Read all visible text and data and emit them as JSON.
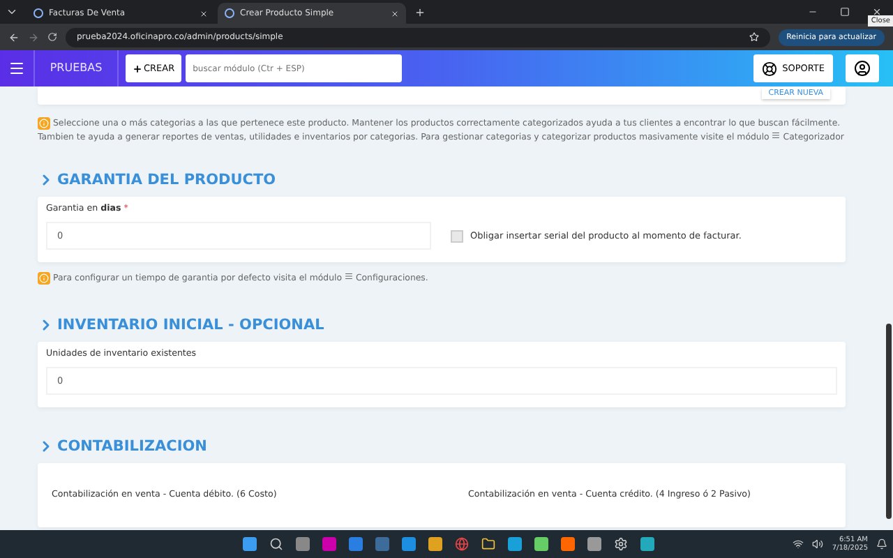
{
  "browser": {
    "tabs": [
      {
        "title": "Facturas De Venta",
        "selected": false
      },
      {
        "title": "Crear Producto Simple",
        "selected": true
      }
    ],
    "url": "prueba2024.oficinapro.co/admin/products/simple",
    "update_button": "Reinicia para actualizar",
    "tooltip": "Close"
  },
  "header": {
    "company": "PRUEBAS",
    "create_button": "CREAR",
    "search": {
      "placeholder": "buscar módulo (Ctr + ESP)"
    },
    "support_button": "SOPORTE"
  },
  "top_card": {
    "button": "CREAR NUEVA"
  },
  "category_note": {
    "text": "Seleccione una o más categorias a las que pertenece este producto. Mantener los productos correctamente categorizados ayuda a tus clientes a encontrar lo que buscan fácilmente. Tambien te ayuda a generar reportes de ventas, utilidades e inventarios por categorias. Para gestionar categorias y categorizar productos masivamente visite el módulo",
    "link": "Categorizador"
  },
  "sections": [
    {
      "title": "GARANTIA DEL PRODUCTO",
      "kind": "warranty",
      "label": "Garantia en **dias**",
      "required_mark": "*",
      "value": "0",
      "checkbox": {
        "label": "Obligar insertar serial del producto al momento de facturar.",
        "checked": false
      },
      "note": {
        "text": "Para configurar un tiempo de garantia por defecto visita el módulo",
        "link": "Configuraciones."
      }
    },
    {
      "title": "INVENTARIO INICIAL - OPCIONAL",
      "kind": "single",
      "label": "Unidades de inventario existentes",
      "value": "0"
    },
    {
      "title": "CONTABILIZACION",
      "kind": "accounts",
      "columns": [
        "Contabilización en venta - Cuenta débito. (6 Costo)",
        "Contabilización en venta - Cuenta crédito. (4 Ingreso ó 2 Pasivo)"
      ]
    }
  ],
  "taskbar": {
    "time": "6:51 AM",
    "date": "7/18/2025"
  }
}
